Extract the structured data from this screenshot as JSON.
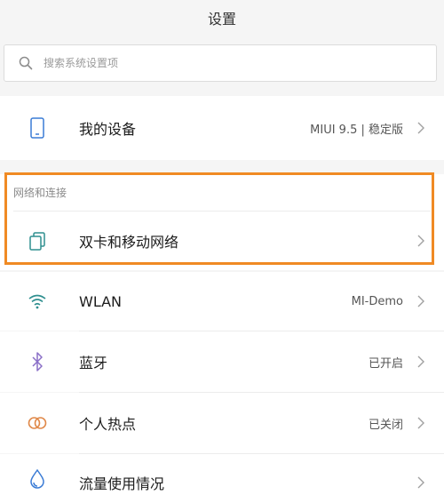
{
  "header": {
    "title": "设置"
  },
  "search": {
    "placeholder": "搜索系统设置项"
  },
  "device_row": {
    "label": "我的设备",
    "value": "MIUI 9.5 | 稳定版",
    "icon": "phone-icon"
  },
  "section": {
    "title": "网络和连接"
  },
  "rows": [
    {
      "label": "双卡和移动网络",
      "value": "",
      "icon": "sim-card-icon"
    },
    {
      "label": "WLAN",
      "value": "MI-Demo",
      "icon": "wifi-icon"
    },
    {
      "label": "蓝牙",
      "value": "已开启",
      "icon": "bluetooth-icon"
    },
    {
      "label": "个人热点",
      "value": "已关闭",
      "icon": "hotspot-icon"
    },
    {
      "label": "流量使用情况",
      "value": "",
      "icon": "data-usage-icon"
    }
  ],
  "colors": {
    "accent": "#f08a24",
    "icon_teal": "#2f8f8f",
    "icon_purple": "#8a6fc7",
    "icon_orange": "#e0894a",
    "icon_blue": "#3a7bd5"
  }
}
